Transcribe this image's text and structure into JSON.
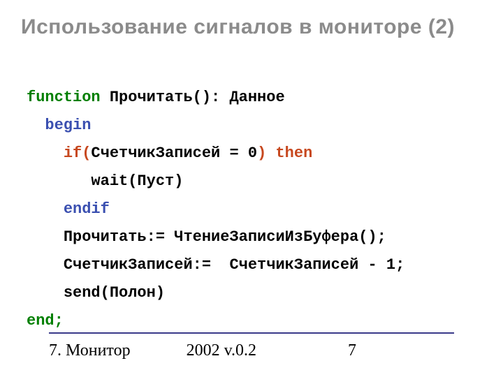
{
  "title": "Использование сигналов в мониторе (2)",
  "code": {
    "l1": {
      "kw": "function",
      "rest": " Прочитать(): Данное"
    },
    "l2": {
      "kw": "begin"
    },
    "l3": {
      "if_open": "if(",
      "cond": "СчетчикЗаписей = 0",
      "if_close": ")",
      "then": " then"
    },
    "l4": {
      "body": "wait(Пуст)"
    },
    "l5": {
      "kw": "endif"
    },
    "l6": {
      "body": "Прочитать:= ЧтениеЗаписиИзБуфера();"
    },
    "l7": {
      "body": "СчетчикЗаписей:=  СчетчикЗаписей - 1;"
    },
    "l8": {
      "body": "send(Полон)"
    },
    "l9": {
      "kw": "end;"
    }
  },
  "footer": {
    "left": "7. Монитор",
    "center": "2002 v.0.2",
    "page": "7"
  }
}
